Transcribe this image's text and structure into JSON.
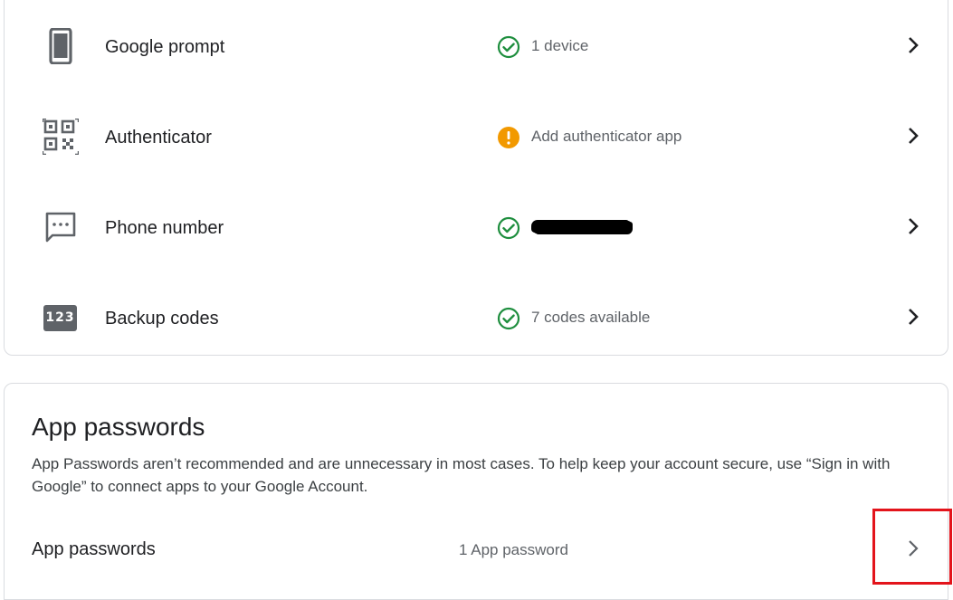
{
  "two_step_methods": [
    {
      "label": "Google prompt",
      "status": "1 device",
      "status_type": "ok",
      "icon": "phone-icon"
    },
    {
      "label": "Authenticator",
      "status": "Add authenticator app",
      "status_type": "warning",
      "icon": "qr-code-icon"
    },
    {
      "label": "Phone number",
      "status": "",
      "status_type": "ok",
      "icon": "sms-icon"
    },
    {
      "label": "Backup codes",
      "status": "7 codes available",
      "status_type": "ok",
      "icon": "backup-codes-icon",
      "icon_text": "123"
    }
  ],
  "app_passwords": {
    "title": "App passwords",
    "description": "App Passwords aren’t recommended and are unnecessary in most cases. To help keep your account secure, use “Sign in with Google” to connect apps to your Google Account.",
    "row_label": "App passwords",
    "row_value": "1 App password"
  },
  "colors": {
    "ok_green": "#1e8e3e",
    "warning_orange": "#f29900",
    "highlight_red": "#e3141b",
    "border": "#dadce0"
  }
}
